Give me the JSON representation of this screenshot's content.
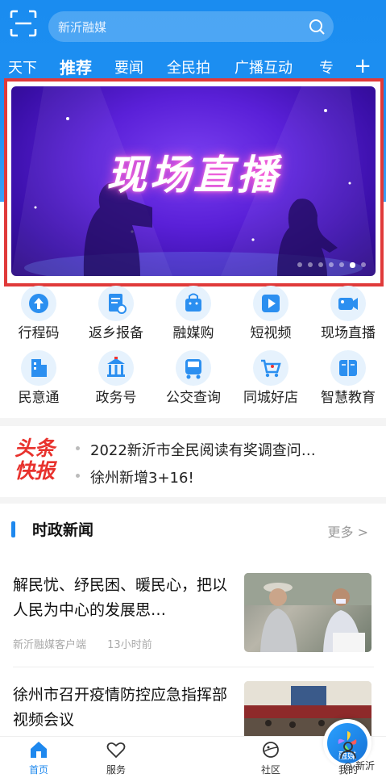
{
  "search": {
    "placeholder": "新沂融媒"
  },
  "tabs": [
    "天下",
    "推荐",
    "要闻",
    "全民拍",
    "广播互动",
    "专"
  ],
  "active_tab": "推荐",
  "banner": {
    "title": "现场直播",
    "slides": 7,
    "active_slide": 6
  },
  "services": [
    {
      "label": "行程码",
      "icon": "arrow-up-icon"
    },
    {
      "label": "返乡报备",
      "icon": "report-icon"
    },
    {
      "label": "融媒购",
      "icon": "shopping-bag-icon"
    },
    {
      "label": "短视频",
      "icon": "play-icon"
    },
    {
      "label": "现场直播",
      "icon": "video-camera-icon"
    },
    {
      "label": "民意通",
      "icon": "building-icon"
    },
    {
      "label": "政务号",
      "icon": "government-icon"
    },
    {
      "label": "公交查询",
      "icon": "bus-icon"
    },
    {
      "label": "同城好店",
      "icon": "cart-icon"
    },
    {
      "label": "智慧教育",
      "icon": "book-icon"
    }
  ],
  "headline": {
    "logo_line1": "头条",
    "logo_line2": "快报",
    "items": [
      "2022新沂市全民阅读有奖调查问…",
      "徐州新增3+16!"
    ]
  },
  "section": {
    "title": "时政新闻",
    "more": "更多 >"
  },
  "news": [
    {
      "title": "解民忧、纾民困、暖民心，把以人民为中心的发展思…",
      "source": "新沂融媒客户端",
      "time": "13小时前"
    },
    {
      "title": "徐州市召开疫情防控应急指挥部视频会议"
    }
  ],
  "navbar": {
    "items": [
      "首页",
      "服务",
      "融媒",
      "社区",
      "我的"
    ],
    "active": "首页"
  },
  "watermark": "新沂"
}
